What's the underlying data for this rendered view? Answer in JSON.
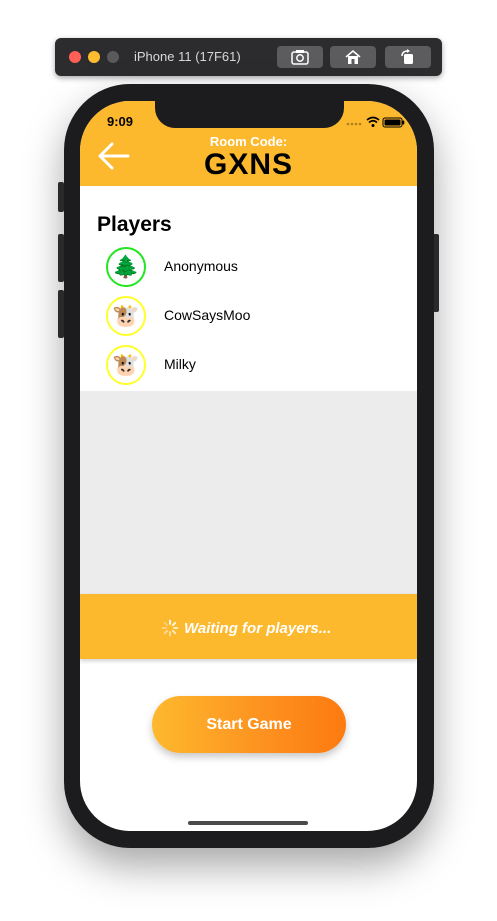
{
  "simulator": {
    "title": "iPhone 11 (17F61)",
    "toolbar_buttons": [
      "screenshot-icon",
      "home-icon",
      "rotate-icon"
    ]
  },
  "status_bar": {
    "time": "9:09"
  },
  "header": {
    "room_label": "Room Code:",
    "room_code": "GXNS",
    "background": "#fdb92e"
  },
  "players": {
    "title": "Players",
    "list": [
      {
        "name": "Anonymous",
        "avatar": "🌲",
        "ring_color": "#22e61f"
      },
      {
        "name": "CowSaysMoo",
        "avatar": "🐮",
        "ring_color": "#ffff2a"
      },
      {
        "name": "Milky",
        "avatar": "🐮",
        "ring_color": "#ffff2a"
      }
    ]
  },
  "status": {
    "text": "Waiting for players..."
  },
  "actions": {
    "start_label": "Start Game"
  },
  "colors": {
    "accent": "#fdb92e",
    "button_gradient_end": "#fd7a10",
    "empty_area": "#ececec"
  }
}
